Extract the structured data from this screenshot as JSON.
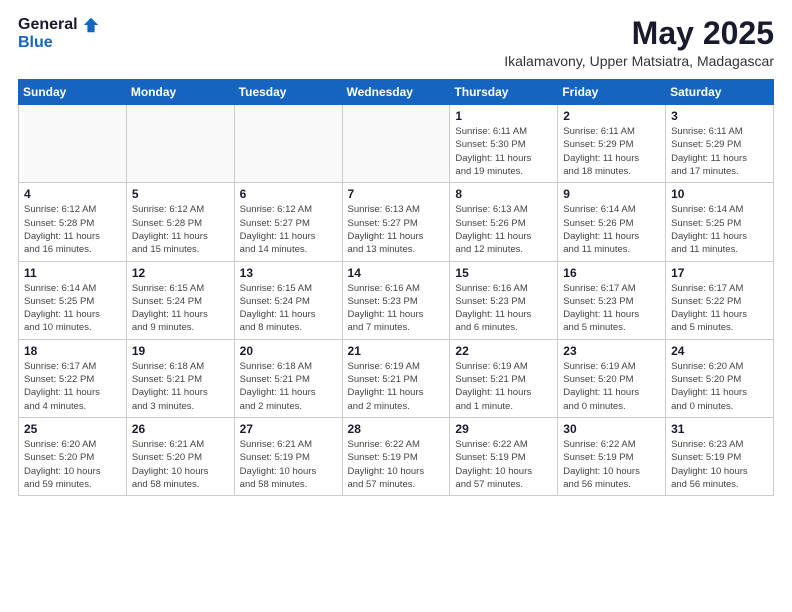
{
  "logo": {
    "general": "General",
    "blue": "Blue"
  },
  "header": {
    "month": "May 2025",
    "location": "Ikalamavony, Upper Matsiatra, Madagascar"
  },
  "weekdays": [
    "Sunday",
    "Monday",
    "Tuesday",
    "Wednesday",
    "Thursday",
    "Friday",
    "Saturday"
  ],
  "weeks": [
    [
      {
        "day": "",
        "info": ""
      },
      {
        "day": "",
        "info": ""
      },
      {
        "day": "",
        "info": ""
      },
      {
        "day": "",
        "info": ""
      },
      {
        "day": "1",
        "info": "Sunrise: 6:11 AM\nSunset: 5:30 PM\nDaylight: 11 hours\nand 19 minutes."
      },
      {
        "day": "2",
        "info": "Sunrise: 6:11 AM\nSunset: 5:29 PM\nDaylight: 11 hours\nand 18 minutes."
      },
      {
        "day": "3",
        "info": "Sunrise: 6:11 AM\nSunset: 5:29 PM\nDaylight: 11 hours\nand 17 minutes."
      }
    ],
    [
      {
        "day": "4",
        "info": "Sunrise: 6:12 AM\nSunset: 5:28 PM\nDaylight: 11 hours\nand 16 minutes."
      },
      {
        "day": "5",
        "info": "Sunrise: 6:12 AM\nSunset: 5:28 PM\nDaylight: 11 hours\nand 15 minutes."
      },
      {
        "day": "6",
        "info": "Sunrise: 6:12 AM\nSunset: 5:27 PM\nDaylight: 11 hours\nand 14 minutes."
      },
      {
        "day": "7",
        "info": "Sunrise: 6:13 AM\nSunset: 5:27 PM\nDaylight: 11 hours\nand 13 minutes."
      },
      {
        "day": "8",
        "info": "Sunrise: 6:13 AM\nSunset: 5:26 PM\nDaylight: 11 hours\nand 12 minutes."
      },
      {
        "day": "9",
        "info": "Sunrise: 6:14 AM\nSunset: 5:26 PM\nDaylight: 11 hours\nand 11 minutes."
      },
      {
        "day": "10",
        "info": "Sunrise: 6:14 AM\nSunset: 5:25 PM\nDaylight: 11 hours\nand 11 minutes."
      }
    ],
    [
      {
        "day": "11",
        "info": "Sunrise: 6:14 AM\nSunset: 5:25 PM\nDaylight: 11 hours\nand 10 minutes."
      },
      {
        "day": "12",
        "info": "Sunrise: 6:15 AM\nSunset: 5:24 PM\nDaylight: 11 hours\nand 9 minutes."
      },
      {
        "day": "13",
        "info": "Sunrise: 6:15 AM\nSunset: 5:24 PM\nDaylight: 11 hours\nand 8 minutes."
      },
      {
        "day": "14",
        "info": "Sunrise: 6:16 AM\nSunset: 5:23 PM\nDaylight: 11 hours\nand 7 minutes."
      },
      {
        "day": "15",
        "info": "Sunrise: 6:16 AM\nSunset: 5:23 PM\nDaylight: 11 hours\nand 6 minutes."
      },
      {
        "day": "16",
        "info": "Sunrise: 6:17 AM\nSunset: 5:23 PM\nDaylight: 11 hours\nand 5 minutes."
      },
      {
        "day": "17",
        "info": "Sunrise: 6:17 AM\nSunset: 5:22 PM\nDaylight: 11 hours\nand 5 minutes."
      }
    ],
    [
      {
        "day": "18",
        "info": "Sunrise: 6:17 AM\nSunset: 5:22 PM\nDaylight: 11 hours\nand 4 minutes."
      },
      {
        "day": "19",
        "info": "Sunrise: 6:18 AM\nSunset: 5:21 PM\nDaylight: 11 hours\nand 3 minutes."
      },
      {
        "day": "20",
        "info": "Sunrise: 6:18 AM\nSunset: 5:21 PM\nDaylight: 11 hours\nand 2 minutes."
      },
      {
        "day": "21",
        "info": "Sunrise: 6:19 AM\nSunset: 5:21 PM\nDaylight: 11 hours\nand 2 minutes."
      },
      {
        "day": "22",
        "info": "Sunrise: 6:19 AM\nSunset: 5:21 PM\nDaylight: 11 hours\nand 1 minute."
      },
      {
        "day": "23",
        "info": "Sunrise: 6:19 AM\nSunset: 5:20 PM\nDaylight: 11 hours\nand 0 minutes."
      },
      {
        "day": "24",
        "info": "Sunrise: 6:20 AM\nSunset: 5:20 PM\nDaylight: 11 hours\nand 0 minutes."
      }
    ],
    [
      {
        "day": "25",
        "info": "Sunrise: 6:20 AM\nSunset: 5:20 PM\nDaylight: 10 hours\nand 59 minutes."
      },
      {
        "day": "26",
        "info": "Sunrise: 6:21 AM\nSunset: 5:20 PM\nDaylight: 10 hours\nand 58 minutes."
      },
      {
        "day": "27",
        "info": "Sunrise: 6:21 AM\nSunset: 5:19 PM\nDaylight: 10 hours\nand 58 minutes."
      },
      {
        "day": "28",
        "info": "Sunrise: 6:22 AM\nSunset: 5:19 PM\nDaylight: 10 hours\nand 57 minutes."
      },
      {
        "day": "29",
        "info": "Sunrise: 6:22 AM\nSunset: 5:19 PM\nDaylight: 10 hours\nand 57 minutes."
      },
      {
        "day": "30",
        "info": "Sunrise: 6:22 AM\nSunset: 5:19 PM\nDaylight: 10 hours\nand 56 minutes."
      },
      {
        "day": "31",
        "info": "Sunrise: 6:23 AM\nSunset: 5:19 PM\nDaylight: 10 hours\nand 56 minutes."
      }
    ]
  ]
}
